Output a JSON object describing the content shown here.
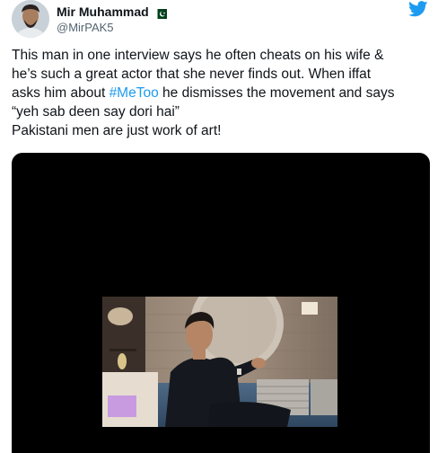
{
  "tweet": {
    "author": {
      "display_name": "Mir Muhammad",
      "handle": "@MirPAK5",
      "flag_icon": "pakistan-flag-icon"
    },
    "logo_icon": "twitter-bird-icon",
    "text_lines": {
      "l1": "This man in one interview says he often cheats on his wife &",
      "l2": "he’s such a great actor that she never finds out. When iffat",
      "l3_pre": "asks him about ",
      "l3_hashtag": "#MeToo",
      "l3_post": " he dismisses the movement and says",
      "l4": "“yeh sab deen say dori hai”",
      "l5": "Pakistani men are just work of art!"
    },
    "colors": {
      "hashtag": "#1d9bf0",
      "twitter_blue": "#1d9bf0",
      "media_background": "#000000"
    }
  }
}
